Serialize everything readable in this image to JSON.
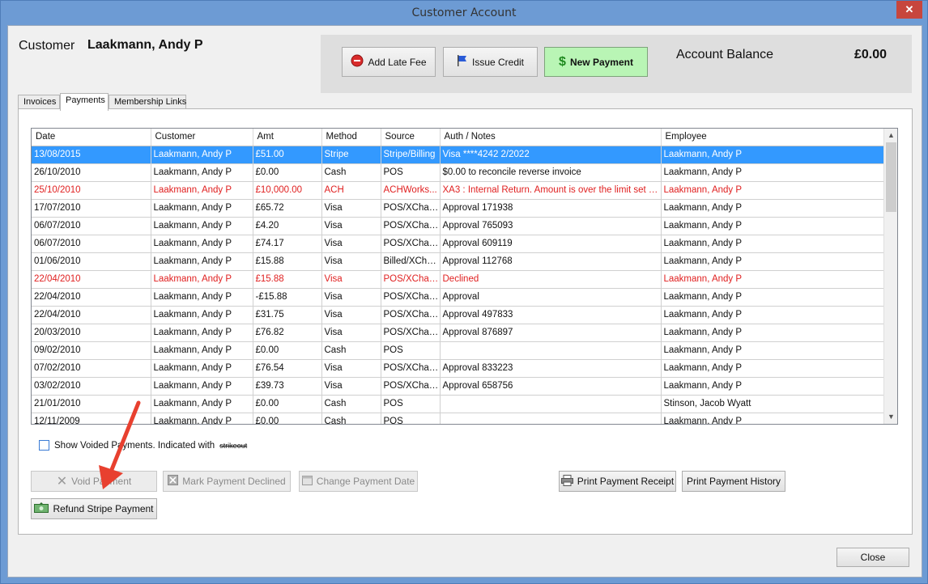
{
  "window": {
    "title": "Customer Account"
  },
  "customer": {
    "label": "Customer",
    "name": "Laakmann, Andy P"
  },
  "toolbar": {
    "add_late_fee": "Add Late Fee",
    "issue_credit": "Issue Credit",
    "new_payment": "New Payment"
  },
  "balance": {
    "label": "Account Balance",
    "value": "£0.00"
  },
  "tabs": [
    "Invoices",
    "Payments",
    "Membership Links"
  ],
  "grid": {
    "columns": [
      "Date",
      "Customer",
      "Amt",
      "Method",
      "Source",
      "Auth / Notes",
      "Employee"
    ],
    "rows": [
      [
        "13/08/2015",
        "Laakmann, Andy P",
        "£51.00",
        "Stripe",
        "Stripe/Billing",
        "Visa ****4242 2/2022",
        "Laakmann, Andy P"
      ],
      [
        "26/10/2010",
        "Laakmann, Andy P",
        "£0.00",
        "Cash",
        "POS",
        "$0.00 to reconcile reverse invoice",
        "Laakmann, Andy P"
      ],
      [
        "25/10/2010",
        "Laakmann, Andy P",
        "£10,000.00",
        "ACH",
        "ACHWorks...",
        "XA3 : Internal Return. Amount is over the limit set for t...",
        "Laakmann, Andy P"
      ],
      [
        "17/07/2010",
        "Laakmann, Andy P",
        "£65.72",
        "Visa",
        "POS/XChar...",
        "Approval 171938",
        "Laakmann, Andy P"
      ],
      [
        "06/07/2010",
        "Laakmann, Andy P",
        "£4.20",
        "Visa",
        "POS/XChar...",
        "Approval 765093",
        "Laakmann, Andy P"
      ],
      [
        "06/07/2010",
        "Laakmann, Andy P",
        "£74.17",
        "Visa",
        "POS/XChar...",
        "Approval 609119",
        "Laakmann, Andy P"
      ],
      [
        "01/06/2010",
        "Laakmann, Andy P",
        "£15.88",
        "Visa",
        "Billed/XCha...",
        "Approval 112768",
        "Laakmann, Andy P"
      ],
      [
        "22/04/2010",
        "Laakmann, Andy P",
        "£15.88",
        "Visa",
        "POS/XChar...",
        "Declined",
        "Laakmann, Andy P"
      ],
      [
        "22/04/2010",
        "Laakmann, Andy P",
        "-£15.88",
        "Visa",
        "POS/XChar...",
        "Approval",
        "Laakmann, Andy P"
      ],
      [
        "22/04/2010",
        "Laakmann, Andy P",
        "£31.75",
        "Visa",
        "POS/XChar...",
        "Approval 497833",
        "Laakmann, Andy P"
      ],
      [
        "20/03/2010",
        "Laakmann, Andy P",
        "£76.82",
        "Visa",
        "POS/XChar...",
        "Approval 876897",
        "Laakmann, Andy P"
      ],
      [
        "09/02/2010",
        "Laakmann, Andy P",
        "£0.00",
        "Cash",
        "POS",
        "",
        "Laakmann, Andy P"
      ],
      [
        "07/02/2010",
        "Laakmann, Andy P",
        "£76.54",
        "Visa",
        "POS/XChar...",
        "Approval 833223",
        "Laakmann, Andy P"
      ],
      [
        "03/02/2010",
        "Laakmann, Andy P",
        "£39.73",
        "Visa",
        "POS/XChar...",
        "Approval 658756",
        "Laakmann, Andy P"
      ],
      [
        "21/01/2010",
        "Laakmann, Andy P",
        "£0.00",
        "Cash",
        "POS",
        "",
        "Stinson, Jacob Wyatt"
      ],
      [
        "12/11/2009",
        "Laakmann, Andy P",
        "£0.00",
        "Cash",
        "POS",
        "",
        "Laakmann, Andy P"
      ]
    ],
    "row_colors": [
      "selected",
      "",
      "red",
      "",
      "",
      "",
      "",
      "red",
      "",
      "",
      "",
      "",
      "",
      "",
      "",
      ""
    ]
  },
  "show_voided": {
    "label": "Show Voided Payments. Indicated with",
    "strike_text": "strikeout"
  },
  "actions": {
    "void_payment": "Void Payment",
    "mark_declined": "Mark Payment Declined",
    "change_date": "Change Payment Date",
    "print_receipt": "Print Payment Receipt",
    "print_history": "Print Payment History",
    "refund_stripe": "Refund Stripe Payment"
  },
  "footer": {
    "close": "Close"
  },
  "colors": {
    "selection": "#3399ff",
    "error_text": "#e02020",
    "new_payment_bg": "#b9f5b5",
    "annotation_arrow": "#e8402f"
  }
}
